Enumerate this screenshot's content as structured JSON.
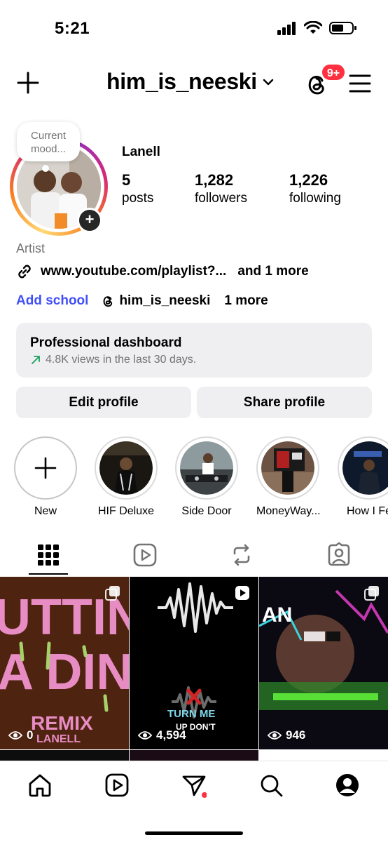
{
  "status": {
    "time": "5:21"
  },
  "header": {
    "username": "him_is_neeski",
    "notification_badge": "9+"
  },
  "profile": {
    "mood_note": "Current mood...",
    "display_name": "Lanell",
    "stats": [
      {
        "value": "5",
        "label": "posts"
      },
      {
        "value": "1,282",
        "label": "followers"
      },
      {
        "value": "1,226",
        "label": "following"
      }
    ],
    "category": "Artist",
    "link": "www.youtube.com/playlist?...",
    "link_more": "and 1 more",
    "add_school": "Add school",
    "threads_handle": "him_is_neeski",
    "threads_more": "1 more"
  },
  "dashboard": {
    "title": "Professional dashboard",
    "subtitle": "4.8K views in the last 30 days."
  },
  "actions": {
    "edit": "Edit profile",
    "share": "Share profile"
  },
  "highlights": [
    {
      "label": "New"
    },
    {
      "label": "HIF Deluxe"
    },
    {
      "label": "Side Door"
    },
    {
      "label": "MoneyWay..."
    },
    {
      "label": "How I Fe"
    }
  ],
  "posts": [
    {
      "views": "0",
      "title_lines": [
        "UTTIN",
        "A DIN"
      ],
      "caption": "REMIX",
      "artist": "LANELL"
    },
    {
      "views": "4,594",
      "caption_top": "TURN ME",
      "caption_bottom": "UP DON'T"
    },
    {
      "views": "946",
      "overlay_text": "AN"
    }
  ],
  "colors": {
    "accent_blue": "#4150f7",
    "badge_red": "#ff3040",
    "card_bg": "#efeff2",
    "secondary_text": "#737373"
  }
}
